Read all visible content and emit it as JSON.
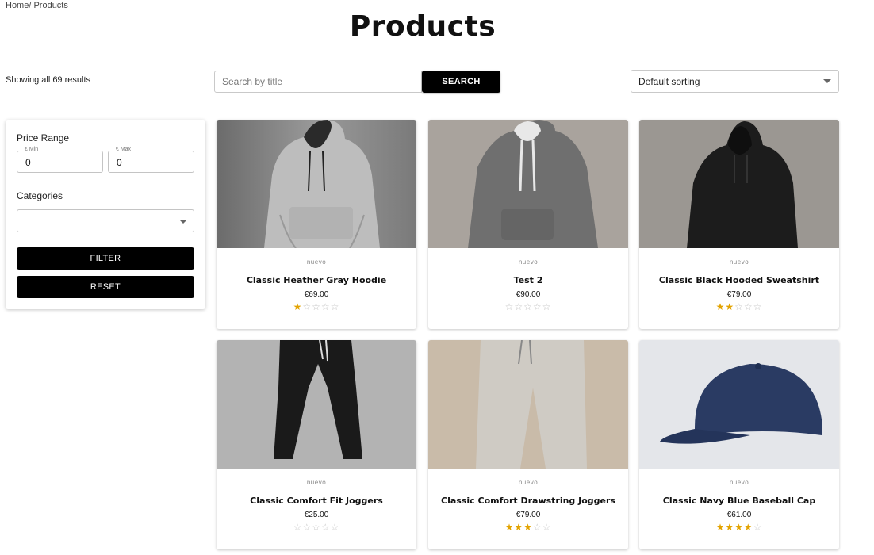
{
  "breadcrumb": "Home/ Products",
  "page_title": "Products",
  "results_text": "Showing all 69 results",
  "search": {
    "placeholder": "Search by title",
    "button_label": "SEARCH"
  },
  "sort": {
    "selected": "Default sorting"
  },
  "filter": {
    "price_range_label": "Price Range",
    "min_legend": "€ Min",
    "min_value": "0",
    "max_legend": "€ Max",
    "max_value": "0",
    "categories_label": "Categories",
    "filter_label": "FILTER",
    "reset_label": "RESET"
  },
  "products": [
    {
      "tag": "nuevo",
      "title": "Classic Heather Gray Hoodie",
      "price": "€69.00",
      "rating": 1
    },
    {
      "tag": "nuevo",
      "title": "Test 2",
      "price": "€90.00",
      "rating": 0
    },
    {
      "tag": "nuevo",
      "title": "Classic Black Hooded Sweatshirt",
      "price": "€79.00",
      "rating": 2
    },
    {
      "tag": "nuevo",
      "title": "Classic Comfort Fit Joggers",
      "price": "€25.00",
      "rating": 0
    },
    {
      "tag": "nuevo",
      "title": "Classic Comfort Drawstring Joggers",
      "price": "€79.00",
      "rating": 3
    },
    {
      "tag": "nuevo",
      "title": "Classic Navy Blue Baseball Cap",
      "price": "€61.00",
      "rating": 4
    }
  ],
  "colors": {
    "accent": "#000000",
    "star": "#e3a300",
    "star_empty": "#c2c2c2"
  }
}
